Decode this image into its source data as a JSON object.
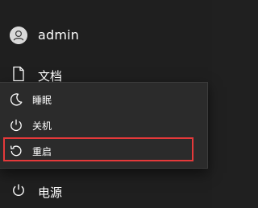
{
  "user": {
    "name": "admin"
  },
  "documents": {
    "label": "文档"
  },
  "power_menu": {
    "items": [
      {
        "label": "睡眠",
        "icon": "moon-icon"
      },
      {
        "label": "关机",
        "icon": "power-icon"
      },
      {
        "label": "重启",
        "icon": "restart-icon"
      }
    ]
  },
  "power_button": {
    "label": "电源",
    "icon": "power-icon"
  },
  "colors": {
    "background": "#1f1f1f",
    "menu_background": "#2b2b2b",
    "highlight_border": "#e5393a",
    "text": "#ffffff"
  }
}
